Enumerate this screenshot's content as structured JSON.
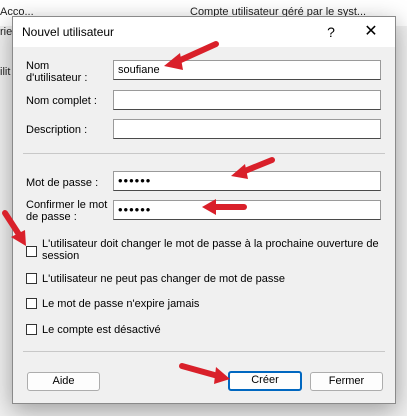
{
  "background": {
    "line1": "Acco...",
    "line2": "rie",
    "line3": "ilit",
    "right_text": "Compte utilisateur géré par le syst..."
  },
  "dialog": {
    "title": "Nouvel utilisateur",
    "help_symbol": "?",
    "close_symbol": "✕"
  },
  "form": {
    "username_label": "Nom d'utilisateur :",
    "username_value": "soufiane",
    "fullname_label": "Nom complet :",
    "fullname_value": "",
    "description_label": "Description :",
    "description_value": "",
    "password_label": "Mot de passe :",
    "password_value": "••••••",
    "confirm_label": "Confirmer le mot de passe :",
    "confirm_value": "••••••"
  },
  "options": [
    {
      "label": "L'utilisateur doit changer le mot de passe à la prochaine ouverture de session",
      "checked": false
    },
    {
      "label": "L'utilisateur ne peut pas changer de mot de passe",
      "checked": false
    },
    {
      "label": "Le mot de passe n'expire jamais",
      "checked": false
    },
    {
      "label": "Le compte est désactivé",
      "checked": false
    }
  ],
  "buttons": {
    "help": "Aide",
    "create": "Créer",
    "close": "Fermer"
  },
  "colors": {
    "annotation_arrow": "#d9202a",
    "primary_button_border": "#0067c0"
  },
  "icons": {
    "arrow": "red-arrow-icon"
  }
}
